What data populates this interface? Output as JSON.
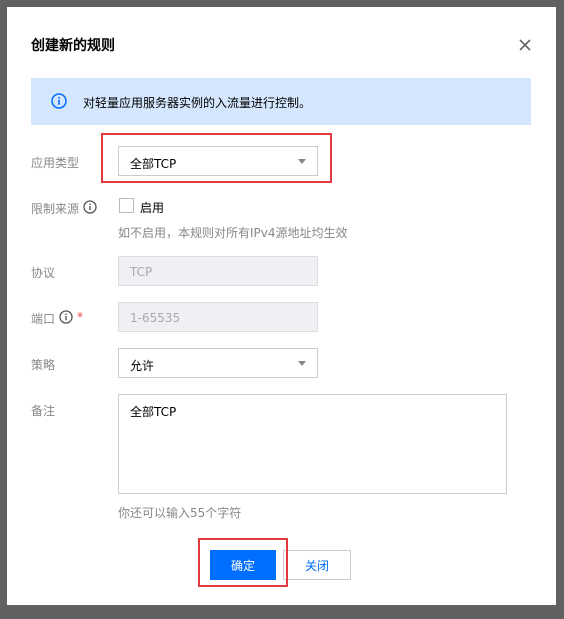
{
  "dialog": {
    "title": "创建新的规则",
    "info_text": "对轻量应用服务器实例的入流量进行控制。"
  },
  "form": {
    "app_type": {
      "label": "应用类型",
      "value": "全部TCP"
    },
    "source_limit": {
      "label": "限制来源",
      "checkbox_label": "启用",
      "checked": false,
      "hint": "如不启用，本规则对所有IPv4源地址均生效"
    },
    "protocol": {
      "label": "协议",
      "value": "TCP"
    },
    "port": {
      "label": "端口",
      "required_mark": "*",
      "value": "1-65535"
    },
    "policy": {
      "label": "策略",
      "value": "允许"
    },
    "remark": {
      "label": "备注",
      "value": "全部TCP",
      "remaining_hint": "你还可以输入55个字符"
    }
  },
  "buttons": {
    "confirm": "确定",
    "close": "关闭"
  },
  "colors": {
    "primary": "#006eff",
    "banner_bg": "#d5e7ff",
    "highlight": "#e0393e",
    "required": "#e54545"
  },
  "icons": {
    "close": "close-icon",
    "info": "info-circle-icon",
    "help": "help-circle-icon",
    "caret": "caret-down-icon"
  }
}
